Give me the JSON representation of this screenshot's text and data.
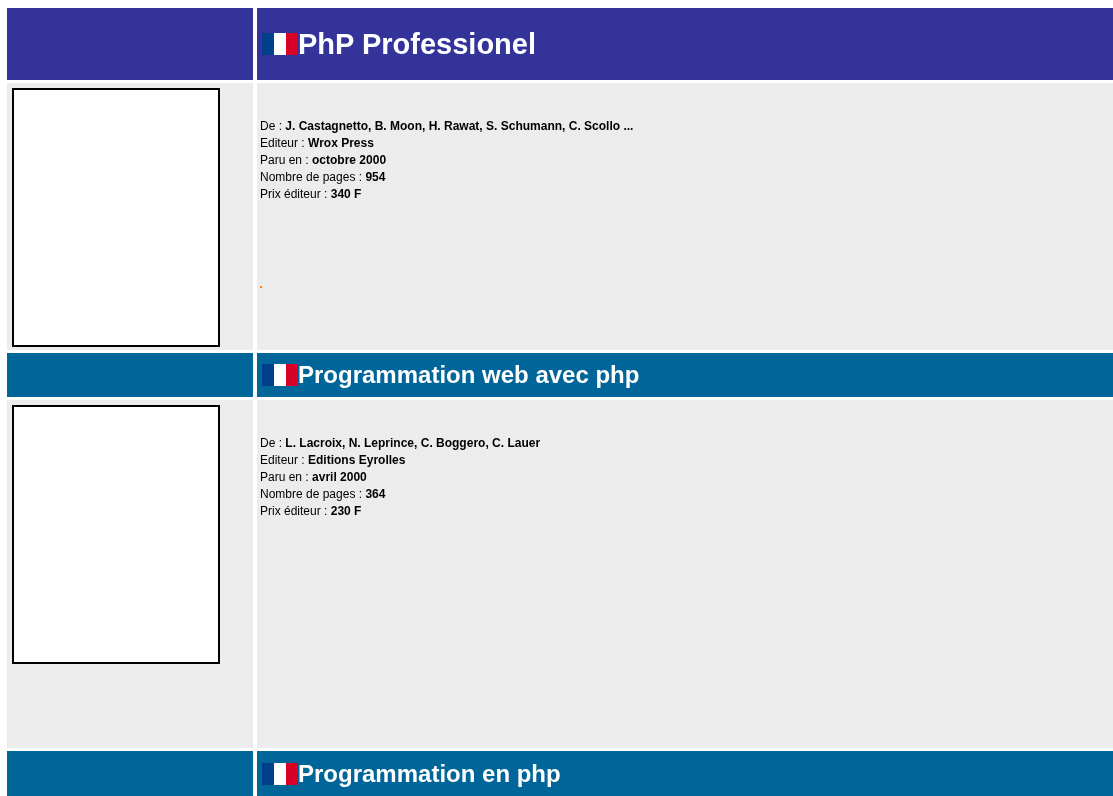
{
  "books": [
    {
      "title": "PhP Professionel",
      "color": "#333399",
      "details": [
        "De : **J. Castagnetto, B. Moon, H. Rawat, S. Schumann, C. Scollo ...**",
        "Editeur : **Wrox Press**",
        "Paru en : **octobre 2000**",
        "Nombre de pages : **954**",
        "Prix éditeur : **340 F**"
      ],
      "marker": true
    },
    {
      "title": "Programmation web avec php",
      "color": "#006699",
      "details": [
        "De : **L. Lacroix, N. Leprince, C. Boggero, C. Lauer**",
        "Editeur : **Editions Eyrolles**",
        "Paru en : **avril 2000**",
        "Nombre de pages : **364**",
        "Prix éditeur : **230 F**"
      ],
      "marker": false
    },
    {
      "title": "Programmation en php",
      "color": "#006699"
    }
  ]
}
